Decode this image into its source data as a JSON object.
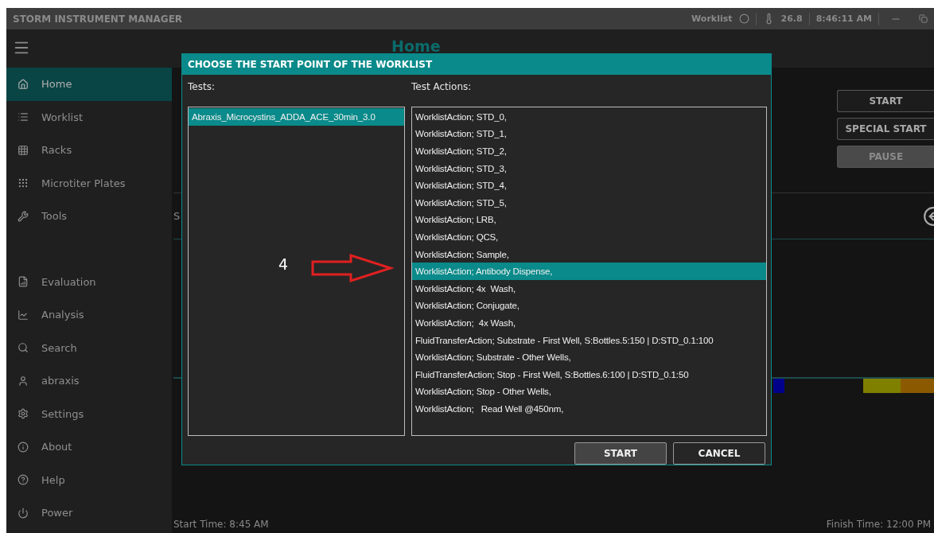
{
  "title_bar": {
    "title": "STORM INSTRUMENT MANAGER",
    "worklist_label": "Worklist",
    "temperature": "26.8",
    "time": "8:46:11 AM"
  },
  "header": {
    "title": "Home"
  },
  "sidebar": {
    "items": [
      {
        "label": "Home",
        "selected": true
      },
      {
        "label": "Worklist",
        "selected": false
      },
      {
        "label": "Racks",
        "selected": false
      },
      {
        "label": "Microtiter Plates",
        "selected": false
      },
      {
        "label": "Tools",
        "selected": false
      },
      {
        "label": "Evaluation",
        "selected": false
      },
      {
        "label": "Analysis",
        "selected": false
      },
      {
        "label": "Search",
        "selected": false
      },
      {
        "label": "abraxis",
        "selected": false
      },
      {
        "label": "Settings",
        "selected": false
      },
      {
        "label": "About",
        "selected": false
      },
      {
        "label": "Help",
        "selected": false
      },
      {
        "label": "Power",
        "selected": false
      }
    ]
  },
  "main": {
    "section_label": "S",
    "buttons": [
      {
        "label": "START",
        "disabled": false
      },
      {
        "label": "SPECIAL START",
        "disabled": false
      },
      {
        "label": "PAUSE",
        "disabled": true
      }
    ],
    "progress_segments": [
      {
        "kind": "run",
        "color": "#00008b"
      },
      {
        "kind": "idle"
      },
      {
        "kind": "run",
        "color": "#808000"
      },
      {
        "kind": "run",
        "color": "#8b5a00"
      }
    ],
    "start_time": "Start Time: 8:45 AM",
    "finish_time": "Finish Time: 12:00 PM"
  },
  "dialog": {
    "title": "CHOOSE THE START POINT OF THE WORKLIST",
    "tests_label": "Tests:",
    "actions_label": "Test Actions:",
    "tests": [
      {
        "label": "Abraxis_Microcystins_ADDA_ACE_30min_3.0",
        "selected": true
      }
    ],
    "actions": [
      {
        "label": "WorklistAction; STD_0,",
        "selected": false
      },
      {
        "label": "WorklistAction; STD_1,",
        "selected": false
      },
      {
        "label": "WorklistAction; STD_2,",
        "selected": false
      },
      {
        "label": "WorklistAction; STD_3,",
        "selected": false
      },
      {
        "label": "WorklistAction; STD_4,",
        "selected": false
      },
      {
        "label": "WorklistAction; STD_5,",
        "selected": false
      },
      {
        "label": "WorklistAction; LRB,",
        "selected": false
      },
      {
        "label": "WorklistAction; QCS,",
        "selected": false
      },
      {
        "label": "WorklistAction; Sample,",
        "selected": false
      },
      {
        "label": "WorklistAction; Antibody Dispense,",
        "selected": true
      },
      {
        "label": "WorklistAction; 4x  Wash,",
        "selected": false
      },
      {
        "label": "WorklistAction; Conjugate,",
        "selected": false
      },
      {
        "label": "WorklistAction;  4x Wash,",
        "selected": false
      },
      {
        "label": "FluidTransferAction; Substrate - First Well, S:Bottles.5:150 | D:STD_0.1:100",
        "selected": false
      },
      {
        "label": "WorklistAction; Substrate - Other Wells,",
        "selected": false
      },
      {
        "label": "FluidTransferAction; Stop - First Well, S:Bottles.6:100 | D:STD_0.1:50",
        "selected": false
      },
      {
        "label": "WorklistAction; Stop - Other Wells,",
        "selected": false
      },
      {
        "label": "WorklistAction;   Read Well @450nm,",
        "selected": false
      }
    ],
    "annotation": {
      "label": "4"
    },
    "buttons": [
      {
        "label": "START",
        "kind": "primary"
      },
      {
        "label": "CANCEL",
        "kind": "secondary"
      }
    ]
  }
}
